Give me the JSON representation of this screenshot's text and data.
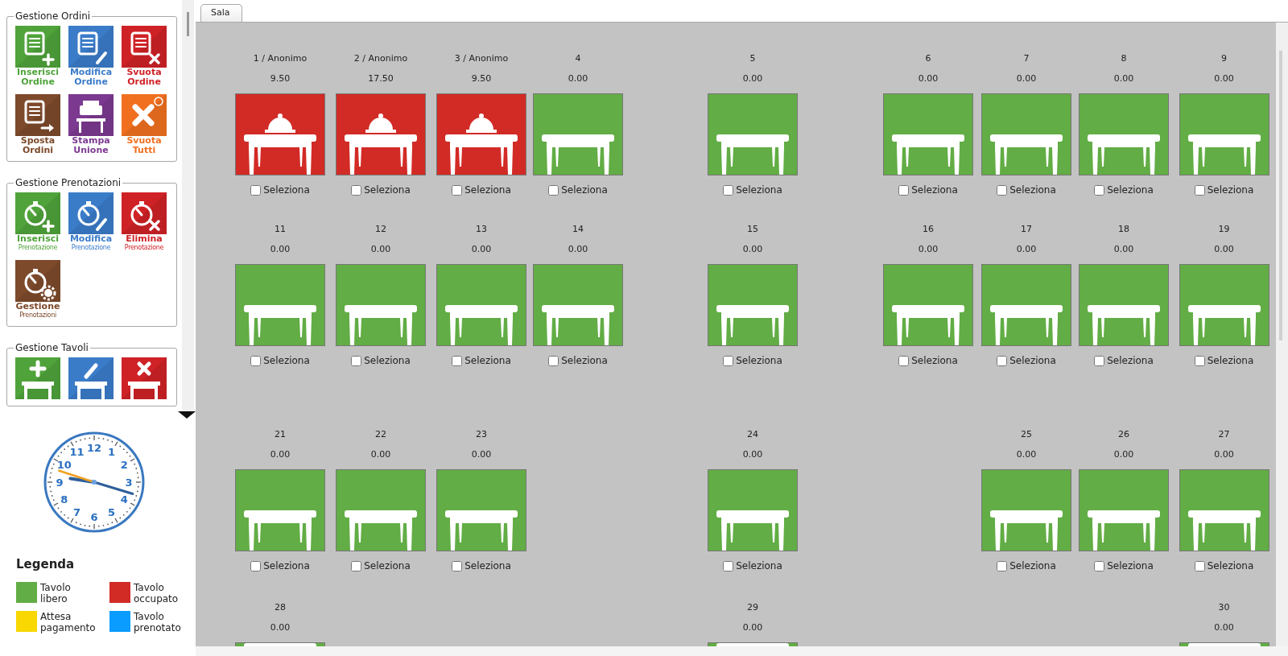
{
  "sidebar": {
    "groups": [
      {
        "title": "Gestione Ordini",
        "kind": "orders",
        "caption_small": false,
        "buttons": [
          {
            "kind": "add",
            "color": "#4fa33a",
            "lines": [
              "Inserisci",
              "Ordine"
            ]
          },
          {
            "kind": "edit",
            "color": "#3b7cc9",
            "lines": [
              "Modifica",
              "Ordine"
            ]
          },
          {
            "kind": "delete",
            "color": "#cf2227",
            "lines": [
              "Svuota",
              "Ordine"
            ]
          },
          {
            "kind": "move",
            "color": "#7d4a2b",
            "lines": [
              "Sposta",
              "Ordini"
            ]
          },
          {
            "kind": "print",
            "color": "#7c3990",
            "lines": [
              "Stampa",
              "Unione"
            ]
          },
          {
            "kind": "clear-all",
            "color": "#f07020",
            "lines": [
              "Svuota",
              "Tutti"
            ]
          }
        ]
      },
      {
        "title": "Gestione Prenotazioni",
        "kind": "reservations",
        "caption_small": true,
        "buttons": [
          {
            "kind": "add",
            "color": "#4fa33a",
            "lines": [
              "Inserisci",
              "Prenotazione"
            ]
          },
          {
            "kind": "edit",
            "color": "#3b7cc9",
            "lines": [
              "Modifica",
              "Prenotazione"
            ]
          },
          {
            "kind": "delete",
            "color": "#cf2227",
            "lines": [
              "Elimina",
              "Prenotazione"
            ]
          },
          {
            "kind": "manage",
            "color": "#7d4a2b",
            "lines": [
              "Gestione",
              "Prenotazioni"
            ]
          }
        ]
      },
      {
        "title": "Gestione Tavoli",
        "kind": "tables",
        "buttons": [
          {
            "kind": "add",
            "color": "#4fa33a"
          },
          {
            "kind": "edit",
            "color": "#3b7cc9"
          },
          {
            "kind": "delete",
            "color": "#cf2227"
          }
        ]
      }
    ]
  },
  "clock": {
    "numerals": [
      "12",
      "11",
      "1",
      "10",
      "2",
      "9",
      "3",
      "8",
      "4",
      "7",
      "5",
      "6"
    ]
  },
  "legend": {
    "title": "Legenda",
    "items": [
      {
        "label": "Tavolo libero",
        "color": "#62ad45"
      },
      {
        "label": "Tavolo occupato",
        "color": "#d22b26"
      },
      {
        "label": "Attesa pagamento",
        "color": "#f8d800"
      },
      {
        "label": "Tavolo prenotato",
        "color": "#0a9cff"
      }
    ]
  },
  "tabs": [
    {
      "label": "Sala",
      "selected": true
    }
  ],
  "floor": {
    "rows": [
      [
        {
          "name": "1 / Anonimo",
          "amount": "9.50",
          "kind": "occupied",
          "color": "#d22b26",
          "checkbox_label": "Seleziona",
          "selected": false
        },
        {
          "name": "2 / Anonimo",
          "amount": "17.50",
          "kind": "occupied",
          "color": "#d22b26",
          "checkbox_label": "Seleziona",
          "selected": false
        },
        {
          "name": "3 / Anonimo",
          "amount": "9.50",
          "kind": "occupied",
          "color": "#d22b26",
          "checkbox_label": "Seleziona",
          "selected": false
        },
        {
          "name": "4",
          "amount": "0.00",
          "kind": "free",
          "color": "#62ad45",
          "checkbox_label": "Seleziona",
          "selected": false
        },
        {
          "name": "5",
          "amount": "0.00",
          "kind": "free",
          "color": "#62ad45",
          "checkbox_label": "Seleziona",
          "selected": false
        },
        {
          "name": "6",
          "amount": "0.00",
          "kind": "free",
          "color": "#62ad45",
          "checkbox_label": "Seleziona",
          "selected": false
        },
        {
          "name": "7",
          "amount": "0.00",
          "kind": "free",
          "color": "#62ad45",
          "checkbox_label": "Seleziona",
          "selected": false
        },
        {
          "name": "8",
          "amount": "0.00",
          "kind": "free",
          "color": "#62ad45",
          "checkbox_label": "Seleziona",
          "selected": false
        },
        {
          "name": "9",
          "amount": "0.00",
          "kind": "free",
          "color": "#62ad45",
          "checkbox_label": "Seleziona",
          "selected": false
        }
      ],
      [
        {
          "name": "11",
          "amount": "0.00",
          "kind": "free",
          "color": "#62ad45",
          "checkbox_label": "Seleziona",
          "selected": false
        },
        {
          "name": "12",
          "amount": "0.00",
          "kind": "free",
          "color": "#62ad45",
          "checkbox_label": "Seleziona",
          "selected": false
        },
        {
          "name": "13",
          "amount": "0.00",
          "kind": "free",
          "color": "#62ad45",
          "checkbox_label": "Seleziona",
          "selected": false
        },
        {
          "name": "14",
          "amount": "0.00",
          "kind": "free",
          "color": "#62ad45",
          "checkbox_label": "Seleziona",
          "selected": false
        },
        {
          "name": "15",
          "amount": "0.00",
          "kind": "free",
          "color": "#62ad45",
          "checkbox_label": "Seleziona",
          "selected": false
        },
        {
          "name": "16",
          "amount": "0.00",
          "kind": "free",
          "color": "#62ad45",
          "checkbox_label": "Seleziona",
          "selected": false
        },
        {
          "name": "17",
          "amount": "0.00",
          "kind": "free",
          "color": "#62ad45",
          "checkbox_label": "Seleziona",
          "selected": false
        },
        {
          "name": "18",
          "amount": "0.00",
          "kind": "free",
          "color": "#62ad45",
          "checkbox_label": "Seleziona",
          "selected": false
        },
        {
          "name": "19",
          "amount": "0.00",
          "kind": "free",
          "color": "#62ad45",
          "checkbox_label": "Seleziona",
          "selected": false
        }
      ],
      [
        {
          "name": "21",
          "amount": "0.00",
          "kind": "free",
          "color": "#62ad45",
          "checkbox_label": "Seleziona",
          "selected": false
        },
        {
          "name": "22",
          "amount": "0.00",
          "kind": "free",
          "color": "#62ad45",
          "checkbox_label": "Seleziona",
          "selected": false
        },
        {
          "name": "23",
          "amount": "0.00",
          "kind": "free",
          "color": "#62ad45",
          "checkbox_label": "Seleziona",
          "selected": false
        },
        "",
        {
          "name": "24",
          "amount": "0.00",
          "kind": "free",
          "color": "#62ad45",
          "checkbox_label": "Seleziona",
          "selected": false
        },
        "",
        {
          "name": "25",
          "amount": "0.00",
          "kind": "free",
          "color": "#62ad45",
          "checkbox_label": "Seleziona",
          "selected": false
        },
        {
          "name": "26",
          "amount": "0.00",
          "kind": "free",
          "color": "#62ad45",
          "checkbox_label": "Seleziona",
          "selected": false
        },
        {
          "name": "27",
          "amount": "0.00",
          "kind": "free",
          "color": "#62ad45",
          "checkbox_label": "Seleziona",
          "selected": false
        }
      ],
      [
        {
          "name": "28",
          "amount": "0.00",
          "kind": "free",
          "color": "#62ad45"
        },
        "",
        "",
        "",
        {
          "name": "29",
          "amount": "0.00",
          "kind": "free",
          "color": "#62ad45"
        },
        "",
        "",
        "",
        {
          "name": "30",
          "amount": "0.00",
          "kind": "free",
          "color": "#62ad45"
        }
      ]
    ]
  }
}
